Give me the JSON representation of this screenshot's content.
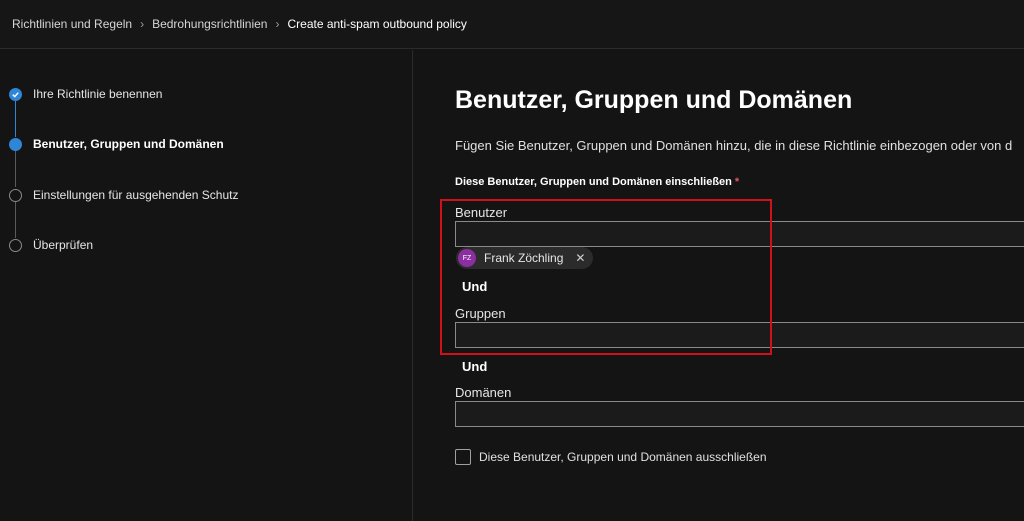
{
  "breadcrumb": {
    "items": [
      "Richtlinien und Regeln",
      "Bedrohungsrichtlinien",
      "Create anti-spam outbound policy"
    ],
    "separator_icon": "chevron-right-icon"
  },
  "steps": [
    {
      "label": "Ihre Richtlinie benennen",
      "state": "done",
      "icon": "check-icon"
    },
    {
      "label": "Benutzer, Gruppen und Domänen",
      "state": "current"
    },
    {
      "label": "Einstellungen für ausgehenden Schutz",
      "state": "pending"
    },
    {
      "label": "Überprüfen",
      "state": "pending"
    }
  ],
  "main": {
    "title": "Benutzer, Gruppen und Domänen",
    "description": "Fügen Sie Benutzer, Gruppen und Domänen hinzu, die in diese Richtlinie einbezogen oder von d",
    "include_label": "Diese Benutzer, Gruppen und Domänen einschließen",
    "required_mark": "*",
    "users_label": "Benutzer",
    "user_chip": {
      "initials": "FZ",
      "name": "Frank Zöchling",
      "remove_icon": "close-icon"
    },
    "and1": "Und",
    "groups_label": "Gruppen",
    "and2": "Und",
    "domains_label": "Domänen",
    "exclude_label": "Diese Benutzer, Gruppen und Domänen ausschließen",
    "exclude_checked": false
  },
  "colors": {
    "background": "#141414",
    "accent": "#2f86d6",
    "highlight": "#d1101a",
    "avatar": "#8a2ea0",
    "required": "#e05a5a"
  }
}
